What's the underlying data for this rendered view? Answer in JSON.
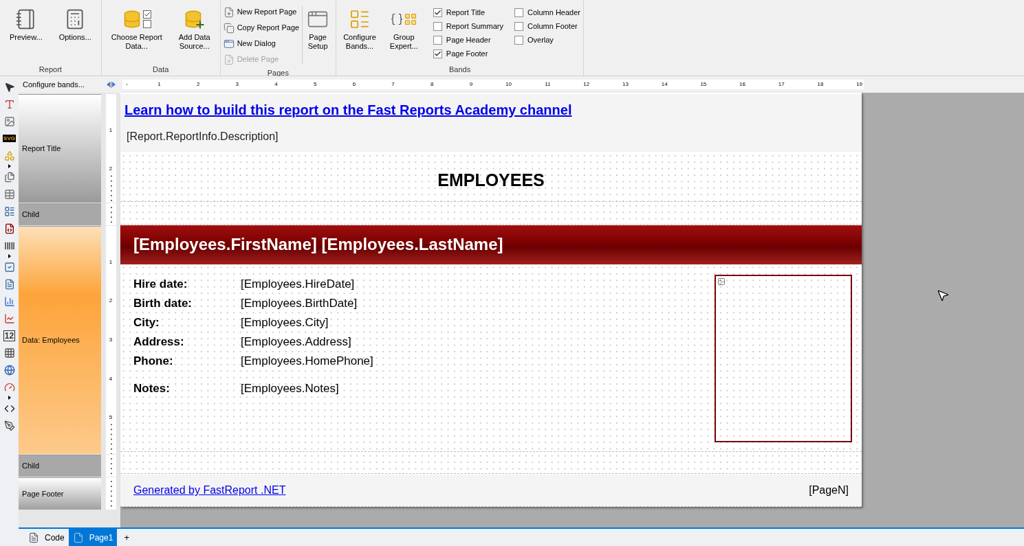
{
  "ribbon": [
    {
      "kind": "large",
      "label": "Report",
      "buttons": [
        "Preview...",
        "Options..."
      ]
    },
    {
      "kind": "large",
      "label": "Data",
      "buttons": [
        "Choose Report\nData...",
        "Add Data\nSource..."
      ]
    },
    {
      "kind": "pages",
      "label": "Pages",
      "items": [
        {
          "label": "New Report Page",
          "disabled": false
        },
        {
          "label": "Copy Report Page",
          "disabled": false
        },
        {
          "label": "New Dialog",
          "disabled": false
        },
        {
          "label": "Delete Page",
          "disabled": true
        }
      ],
      "buttons": [
        "Page\nSetup"
      ]
    },
    {
      "kind": "bands",
      "label": "Bands",
      "buttons": [
        "Configure\nBands...",
        "Group\nExpert..."
      ],
      "check_columns": [
        [
          {
            "label": "Report Title",
            "checked": true
          },
          {
            "label": "Report Summary",
            "checked": false
          },
          {
            "label": "Page Header",
            "checked": false
          },
          {
            "label": "Page Footer",
            "checked": true
          }
        ],
        [
          {
            "label": "Column Header",
            "checked": false
          },
          {
            "label": "Column Footer",
            "checked": false
          },
          {
            "label": "Overlay",
            "checked": false
          }
        ]
      ]
    }
  ],
  "toolbox": [
    {
      "kind": "pointer"
    },
    {
      "kind": "text"
    },
    {
      "kind": "picture"
    },
    {
      "kind": "svg",
      "label": "SVG"
    },
    {
      "kind": "shapes"
    },
    {
      "kind": "more"
    },
    {
      "kind": "subreport"
    },
    {
      "kind": "table"
    },
    {
      "kind": "matrix"
    },
    {
      "kind": "cross"
    },
    {
      "kind": "barcode"
    },
    {
      "kind": "more"
    },
    {
      "kind": "checkbox"
    },
    {
      "kind": "richtext"
    },
    {
      "kind": "chart"
    },
    {
      "kind": "sparkline"
    },
    {
      "kind": "digital",
      "label": "12"
    },
    {
      "kind": "cellular"
    },
    {
      "kind": "map"
    },
    {
      "kind": "gauge"
    },
    {
      "kind": "more"
    },
    {
      "kind": "html"
    },
    {
      "kind": "signature"
    }
  ],
  "band_panel_header": "Configure bands...",
  "ruler": [
    "1",
    "2",
    "3",
    "4",
    "5",
    "6",
    "7",
    "8",
    "9",
    "10",
    "11",
    "12",
    "13",
    "14",
    "15",
    "16",
    "17",
    "18",
    "19"
  ],
  "bands": [
    {
      "kind": "title",
      "label": "Report Title",
      "ruler": [
        "1",
        "2"
      ]
    },
    {
      "kind": "child",
      "label": "Child"
    },
    {
      "kind": "data",
      "label": "Data: Employees",
      "ruler": [
        "1",
        "2",
        "3",
        "4",
        "5"
      ]
    },
    {
      "kind": "child",
      "label": "Child"
    },
    {
      "kind": "footer",
      "label": "Page Footer"
    }
  ],
  "report": {
    "link": "Learn how to build this report on the Fast Reports Academy channel",
    "description": "[Report.ReportInfo.Description]",
    "heading": "EMPLOYEES",
    "data_header": "[Employees.FirstName] [Employees.LastName]",
    "fields": [
      {
        "label": "Hire date:",
        "value": "[Employees.HireDate]"
      },
      {
        "label": "Birth date:",
        "value": "[Employees.BirthDate]"
      },
      {
        "label": "City:",
        "value": "[Employees.City]"
      },
      {
        "label": "Address:",
        "value": "[Employees.Address]"
      },
      {
        "label": "Phone:",
        "value": "[Employees.HomePhone]"
      },
      {
        "label": "Notes:",
        "value": "[Employees.Notes]"
      }
    ],
    "footer_link": "Generated by FastReport .NET",
    "page_number": "[PageN]"
  },
  "tabs": [
    {
      "label": "Code",
      "selected": false
    },
    {
      "label": "Page1",
      "selected": true
    }
  ],
  "add_tab": "+"
}
